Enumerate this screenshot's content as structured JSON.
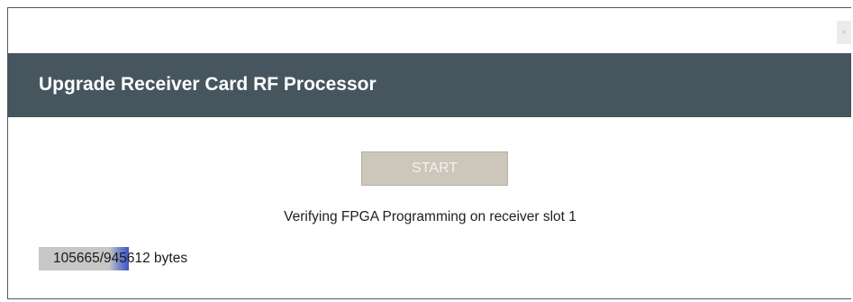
{
  "window": {
    "close_label": "×"
  },
  "header": {
    "title": "Upgrade Receiver Card RF Processor"
  },
  "controls": {
    "start_label": "START"
  },
  "status": {
    "message": "Verifying FPGA Programming on receiver slot 1"
  },
  "progress": {
    "text": "105665/945612 bytes",
    "current_bytes": 105665,
    "total_bytes": 945612,
    "bar_fraction": 1.0
  },
  "colors": {
    "header_bg": "#46555e",
    "header_text": "#ffffff",
    "button_disabled_bg": "#ccc6bb",
    "progress_accent": "#3f55c8"
  },
  "icons": {
    "close": "close-icon"
  }
}
